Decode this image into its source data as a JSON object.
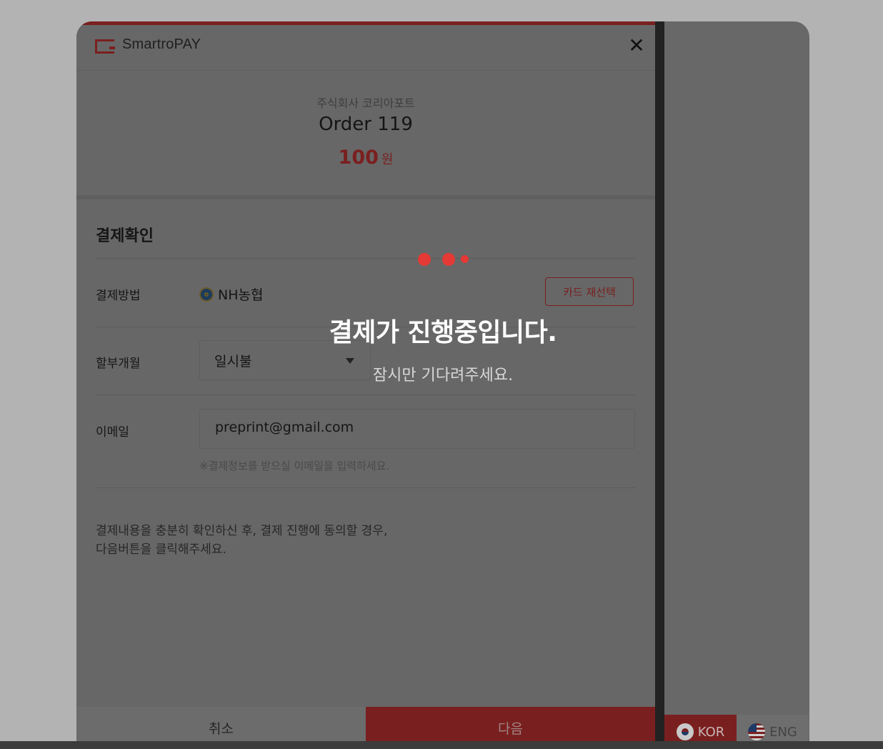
{
  "brand": {
    "logo_text": "SmartroPAY"
  },
  "summary": {
    "merchant": "주식회사 코리아포트",
    "order": "Order 119",
    "amount": "100",
    "currency": "원"
  },
  "section_title": "결제확인",
  "payment_method": {
    "label": "결제방법",
    "value": "NH농협",
    "reselect_label": "카드 재선택"
  },
  "installment": {
    "label": "할부개월",
    "selected": "일시불"
  },
  "email": {
    "label": "이메일",
    "value": "preprint@gmail.com",
    "hint": "※결제정보를 받으실 이메일을 입력하세요."
  },
  "notice": {
    "line1": "결제내용을 충분히 확인하신 후, 결제 진행에 동의할 경우,",
    "line2": "다음버튼을 클릭해주세요."
  },
  "buttons": {
    "cancel": "취소",
    "next": "다음"
  },
  "languages": {
    "kor": "KOR",
    "eng": "ENG"
  },
  "loading": {
    "title": "결제가 진행중입니다.",
    "subtitle": "잠시만 기다려주세요."
  },
  "colors": {
    "accent": "#e53935",
    "overlay_text": "#ffffff"
  },
  "icons": [
    "smartro-logo-icon",
    "close-icon",
    "nh-bank-icon",
    "chevron-down-icon",
    "korea-flag-icon",
    "us-flag-icon"
  ]
}
